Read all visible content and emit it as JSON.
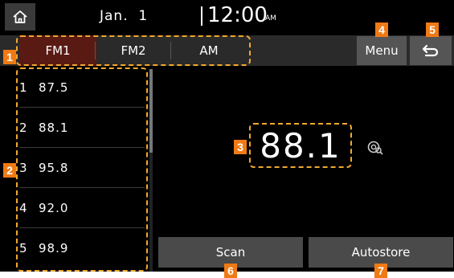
{
  "status": {
    "date": "Jan.  1",
    "time": "12:00",
    "ampm": "AM"
  },
  "band_tabs": [
    {
      "label": "FM1",
      "selected": true
    },
    {
      "label": "FM2",
      "selected": false
    },
    {
      "label": "AM",
      "selected": false
    }
  ],
  "header": {
    "menu_label": "Menu"
  },
  "presets": [
    {
      "num": "1",
      "freq": "87.5"
    },
    {
      "num": "2",
      "freq": "88.1"
    },
    {
      "num": "3",
      "freq": "95.8"
    },
    {
      "num": "4",
      "freq": "92.0"
    },
    {
      "num": "5",
      "freq": "98.9"
    }
  ],
  "main": {
    "frequency": "88.1"
  },
  "buttons": {
    "scan_label": "Scan",
    "autostore_label": "Autostore"
  },
  "callouts": [
    "1",
    "2",
    "3",
    "4",
    "5",
    "6",
    "7"
  ],
  "icons": {
    "home": "home-icon",
    "back": "back-arrow-icon",
    "hd": "hd-radio-icon"
  },
  "colors": {
    "selected_tab": "#5a1a14",
    "callout_label": "#f07a14",
    "callout_outline": "#f1a830"
  }
}
